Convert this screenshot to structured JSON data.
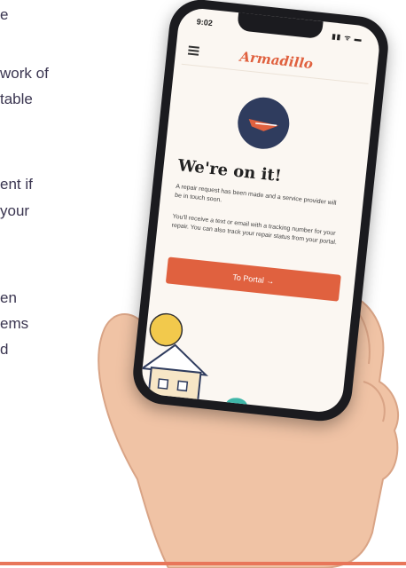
{
  "left_text": {
    "lines": [
      "e",
      "work of",
      "table",
      "ent if",
      "your",
      "en",
      "ems",
      "d"
    ]
  },
  "phone": {
    "status_time": "9:02",
    "status_icons": "▮▮ ᯤ ▬",
    "brand": "Armadillo",
    "headline": "We're on it!",
    "paragraph_1": "A repair request has been made and a service provider will be in touch soon.",
    "paragraph_2": "You'll receive a text or email with a tracking number for your repair. You can also track your repair status from your portal.",
    "portal_button": "To Portal  →"
  },
  "colors": {
    "accent": "#e0613f",
    "navy": "#2f3c5e",
    "text_dark": "#3a3550",
    "bottom_rule": "#e8765a"
  }
}
